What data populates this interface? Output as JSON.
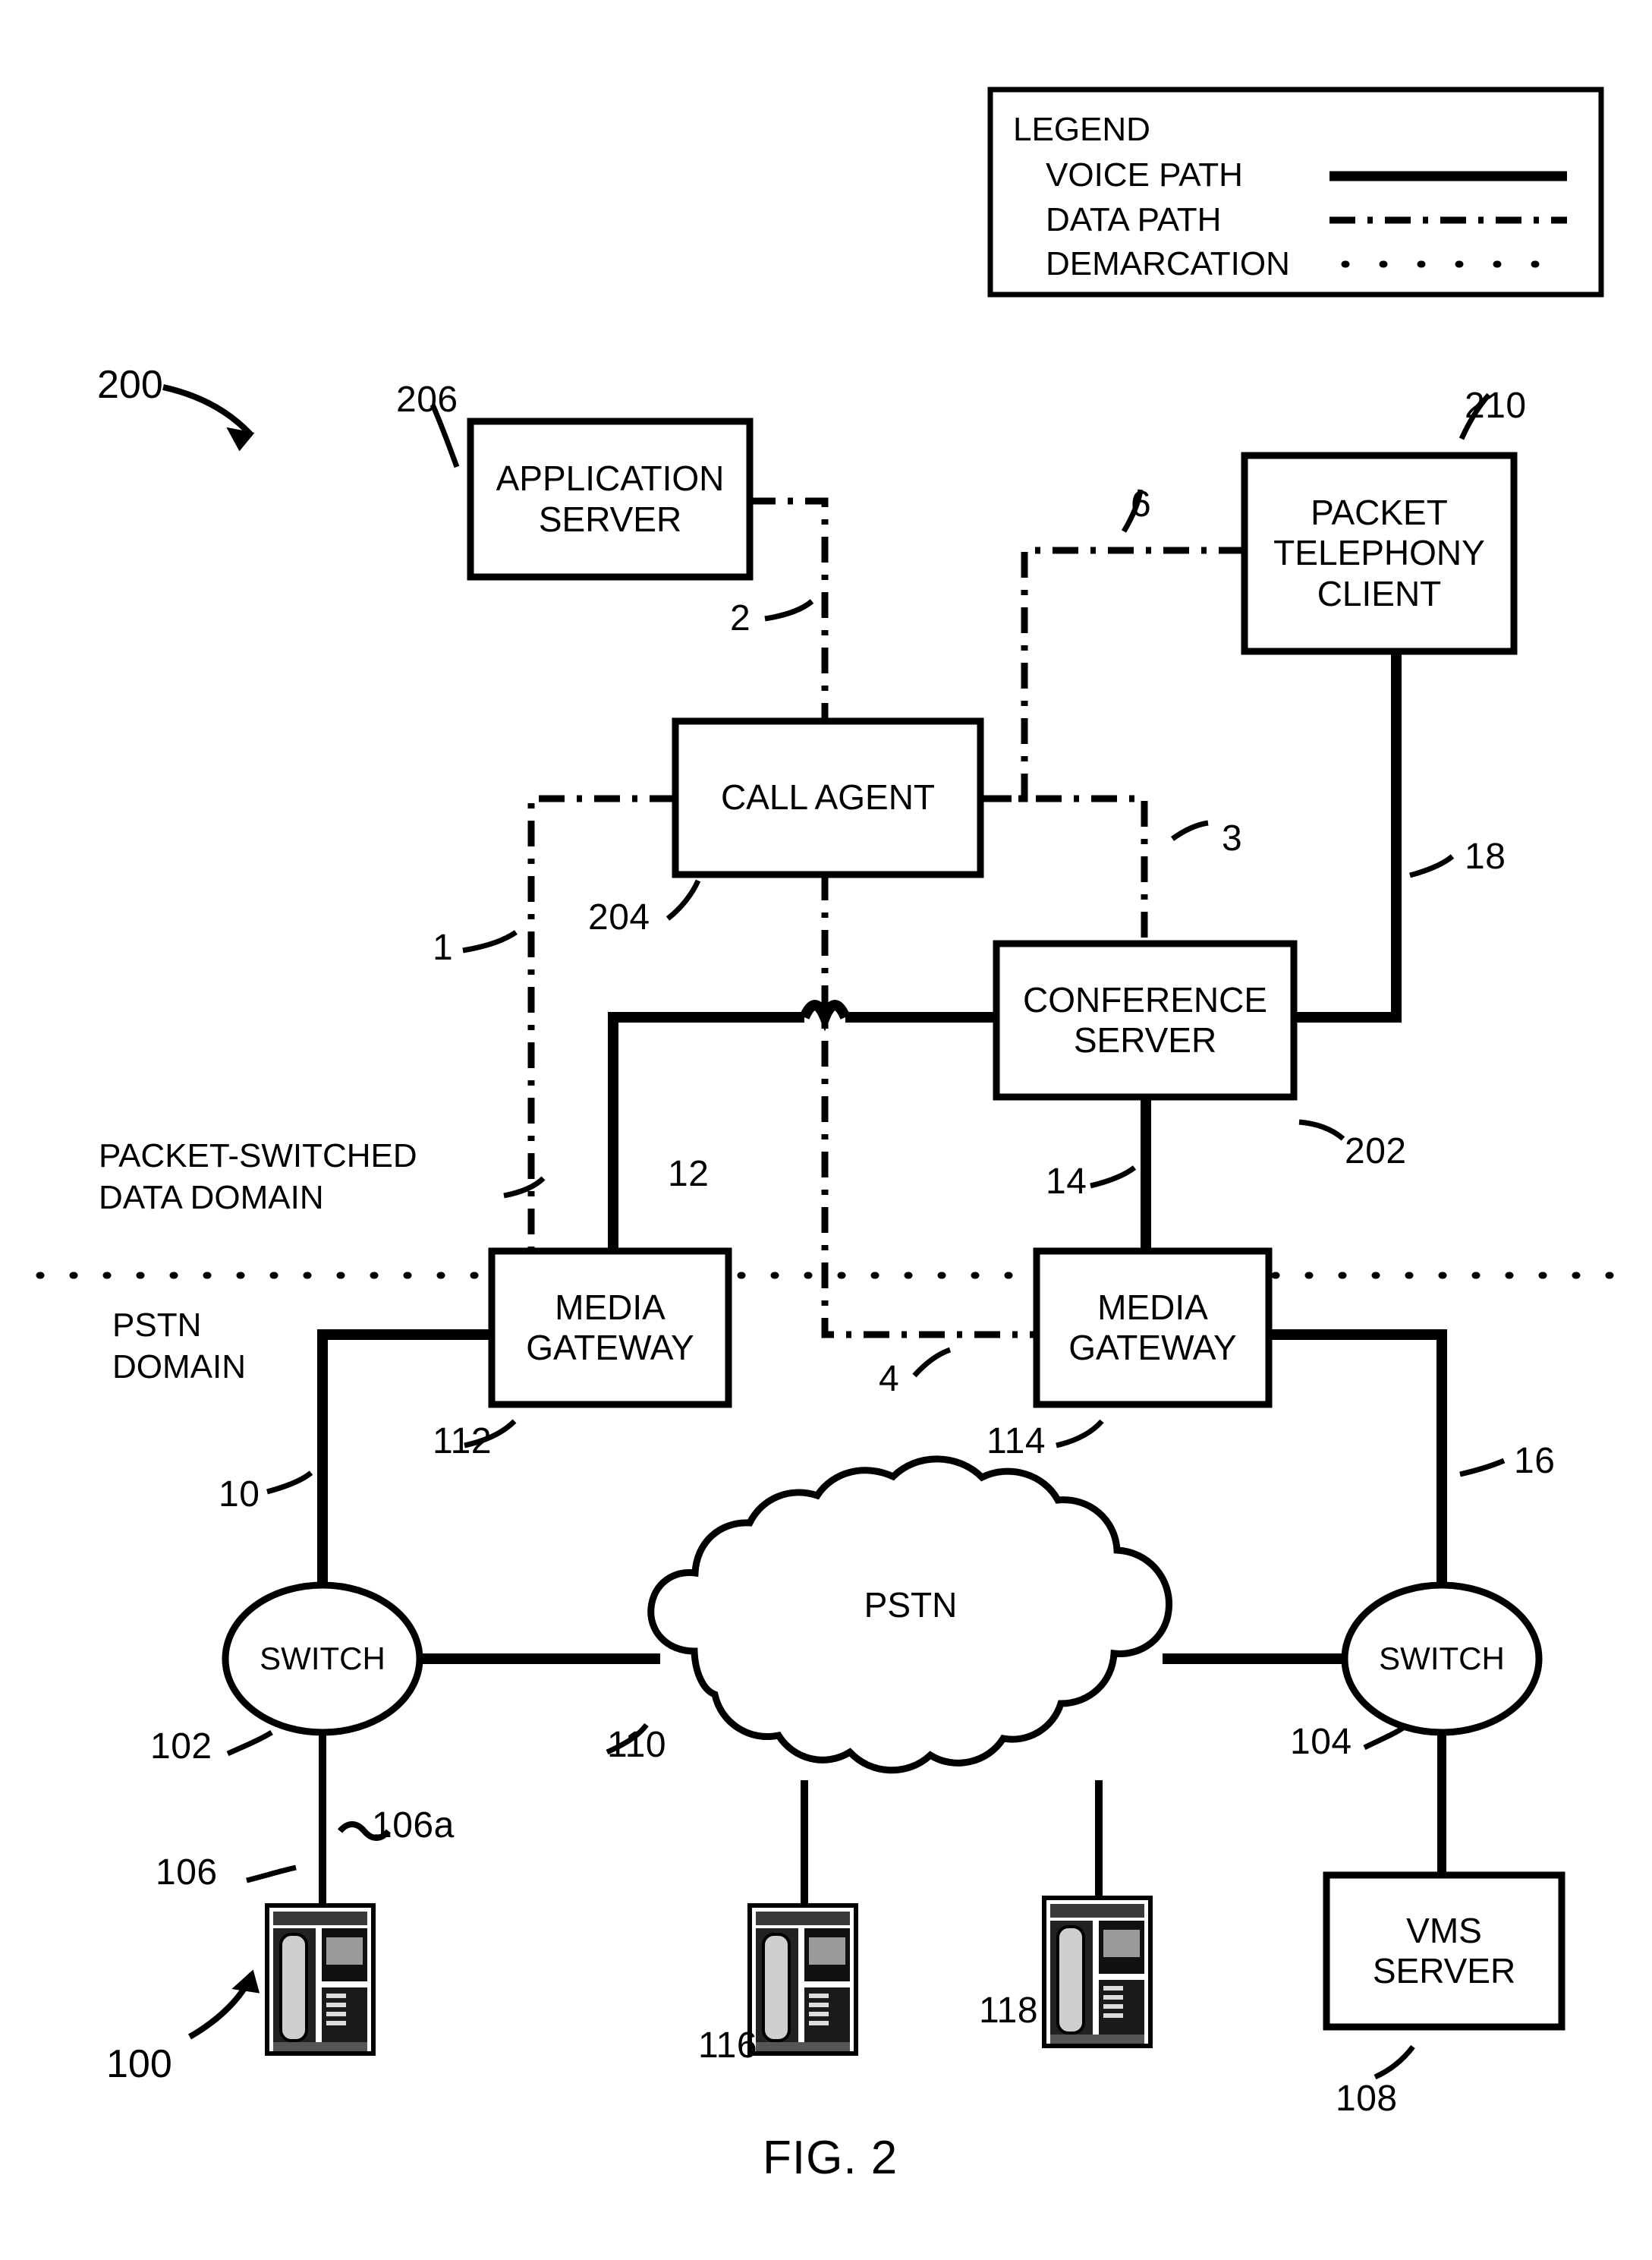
{
  "figure": {
    "caption": "FIG. 2",
    "system_ref_top": "200",
    "system_ref_bottom": "100"
  },
  "legend": {
    "title": "LEGEND",
    "items": [
      {
        "label": "VOICE PATH",
        "style": "solid"
      },
      {
        "label": "DATA PATH",
        "style": "dash-dot"
      },
      {
        "label": "DEMARCATION",
        "style": "dotted"
      }
    ]
  },
  "domains": [
    {
      "name": "packet-switched-data-domain",
      "label": "PACKET-SWITCHED\nDATA DOMAIN"
    },
    {
      "name": "pstn-domain",
      "label": "PSTN\nDOMAIN"
    }
  ],
  "nodes": [
    {
      "id": "application-server",
      "label": "APPLICATION\nSERVER",
      "ref": "206",
      "shape": "rect"
    },
    {
      "id": "packet-telephony-client",
      "label": "PACKET\nTELEPHONY\nCLIENT",
      "ref": "210",
      "shape": "rect"
    },
    {
      "id": "call-agent",
      "label": "CALL AGENT",
      "ref": "204",
      "shape": "rect"
    },
    {
      "id": "conference-server",
      "label": "CONFERENCE\nSERVER",
      "ref": "202",
      "shape": "rect"
    },
    {
      "id": "media-gateway-left",
      "label": "MEDIA\nGATEWAY",
      "ref": "112",
      "shape": "rect"
    },
    {
      "id": "media-gateway-right",
      "label": "MEDIA\nGATEWAY",
      "ref": "114",
      "shape": "rect"
    },
    {
      "id": "switch-left",
      "label": "SWITCH",
      "ref": "102",
      "shape": "ellipse"
    },
    {
      "id": "switch-right",
      "label": "SWITCH",
      "ref": "104",
      "shape": "ellipse"
    },
    {
      "id": "pstn-cloud",
      "label": "PSTN",
      "ref": "110",
      "shape": "cloud"
    },
    {
      "id": "vms-server",
      "label": "VMS\nSERVER",
      "ref": "108",
      "shape": "rect"
    },
    {
      "id": "telephone-left",
      "label": "",
      "ref": "106",
      "shape": "phone"
    },
    {
      "id": "telephone-middle",
      "label": "",
      "ref": "116",
      "shape": "phone"
    },
    {
      "id": "telephone-right-of-middle",
      "label": "",
      "ref": "118",
      "shape": "phone"
    }
  ],
  "link_refs": [
    {
      "id": "link-1",
      "label": "1",
      "type": "data"
    },
    {
      "id": "link-2",
      "label": "2",
      "type": "data"
    },
    {
      "id": "link-3",
      "label": "3",
      "type": "data"
    },
    {
      "id": "link-4",
      "label": "4",
      "type": "data"
    },
    {
      "id": "link-6",
      "label": "6",
      "type": "data"
    },
    {
      "id": "link-10",
      "label": "10",
      "type": "voice"
    },
    {
      "id": "link-12",
      "label": "12",
      "type": "voice"
    },
    {
      "id": "link-14",
      "label": "14",
      "type": "voice"
    },
    {
      "id": "link-16",
      "label": "16",
      "type": "voice"
    },
    {
      "id": "link-18",
      "label": "18",
      "type": "voice"
    },
    {
      "id": "link-106a",
      "label": "106a",
      "type": "voice"
    }
  ]
}
